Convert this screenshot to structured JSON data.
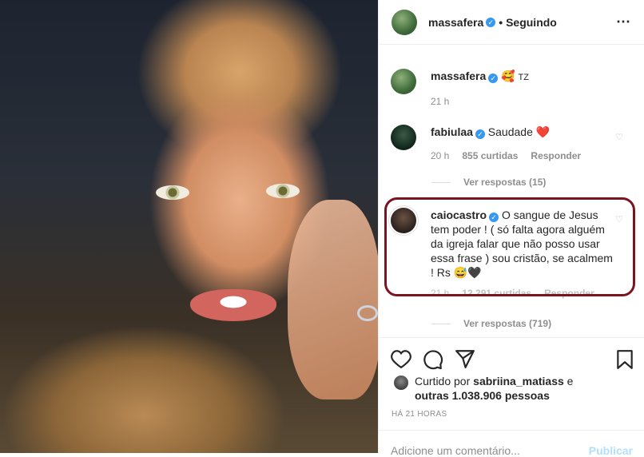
{
  "header": {
    "username": "massafera",
    "follow_status": "• Seguindo",
    "more_icon": "more-horizontal-icon"
  },
  "caption": {
    "username": "massafera",
    "emoji": "🥰",
    "text": "TZ",
    "time": "21 h"
  },
  "comments": [
    {
      "username": "fabiulaa",
      "text": "Saudade",
      "emoji": "❤️",
      "time": "20 h",
      "likes": "855 curtidas",
      "reply": "Responder",
      "view_replies": "Ver respostas (15)"
    },
    {
      "username": "caiocastro",
      "text": "O sangue de Jesus tem poder ! ( só falta agora alguém da igreja falar que não posso usar essa frase ) sou cristão, se acalmem ! Rs",
      "emoji": "😅🖤",
      "time": "21 h",
      "likes": "12.291 curtidas",
      "reply": "Responder",
      "view_replies": "Ver respostas (719)"
    }
  ],
  "likes_line": {
    "prefix": "Curtido por",
    "user": "sabriina_matiass",
    "conj": "e",
    "others": "outras 1.038.906 pessoas"
  },
  "time_ago": "HÁ 21 HORAS",
  "add_comment": {
    "placeholder": "Adicione um comentário...",
    "publish": "Publicar"
  },
  "colors": {
    "verified": "#3897f0",
    "highlight": "#7a1520",
    "heart": "#ed4956"
  }
}
